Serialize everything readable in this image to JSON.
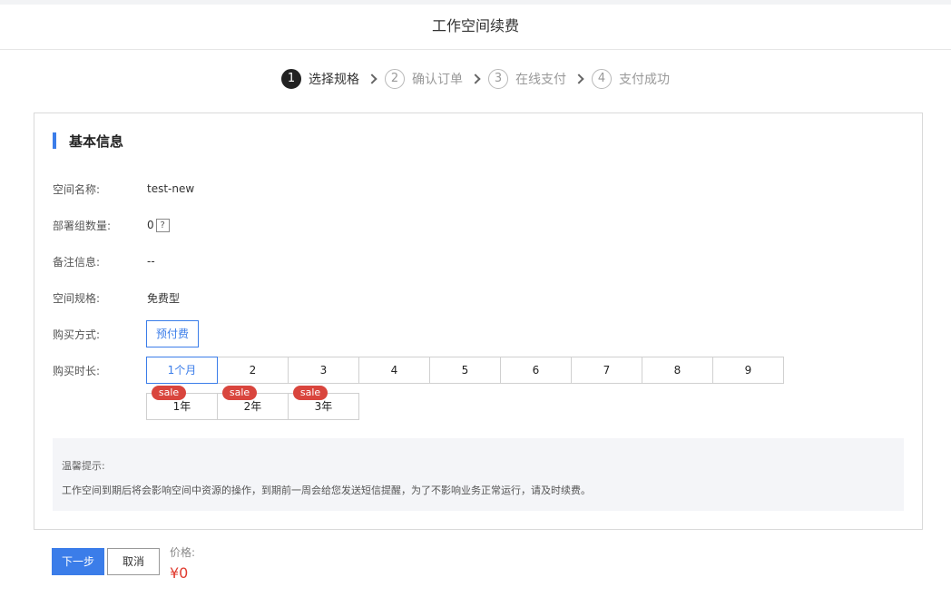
{
  "page": {
    "title": "工作空间续费"
  },
  "steps": [
    {
      "num": "1",
      "label": "选择规格",
      "active": true
    },
    {
      "num": "2",
      "label": "确认订单",
      "active": false
    },
    {
      "num": "3",
      "label": "在线支付",
      "active": false
    },
    {
      "num": "4",
      "label": "支付成功",
      "active": false
    }
  ],
  "section": {
    "title": "基本信息"
  },
  "fields": {
    "space_name": {
      "label": "空间名称:",
      "value": "test-new"
    },
    "deploy_count": {
      "label": "部署组数量:",
      "value": "0",
      "help": "?"
    },
    "remark": {
      "label": "备注信息:",
      "value": "--"
    },
    "spec": {
      "label": "空间规格:",
      "value": "免费型"
    },
    "purchase_mode": {
      "label": "购买方式:",
      "value": "预付费"
    },
    "duration": {
      "label": "购买时长:",
      "months": [
        "1个月",
        "2",
        "3",
        "4",
        "5",
        "6",
        "7",
        "8",
        "9"
      ],
      "years": [
        "1年",
        "2年",
        "3年"
      ],
      "sale_badge": "sale",
      "selected": "1个月"
    }
  },
  "tips": {
    "title": "温馨提示:",
    "body": "工作空间到期后将会影响空间中资源的操作，到期前一周会给您发送短信提醒，为了不影响业务正常运行，请及时续费。"
  },
  "footer": {
    "next_label": "下一步",
    "cancel_label": "取消",
    "price_label": "价格:",
    "price_value": "¥0"
  },
  "colors": {
    "accent": "#3b7de9",
    "sale": "#d9453d",
    "price": "#e03b2f"
  }
}
